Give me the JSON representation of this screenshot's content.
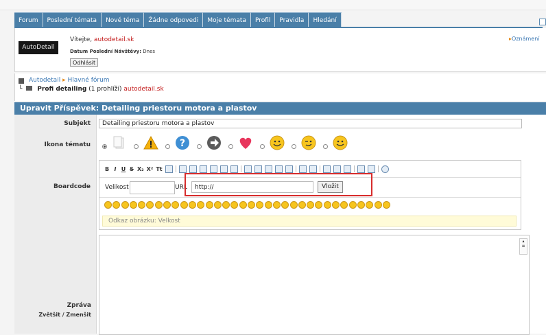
{
  "nav": {
    "tabs": [
      "Forum",
      "Poslední témata",
      "Nové téma",
      "Žádne odpovedi",
      "Moje témata",
      "Profil",
      "Pravidla",
      "Hledání"
    ]
  },
  "welcome": {
    "logo_text": "AutoDetail",
    "greeting": "Vítejte,",
    "username": "autodetail.sk",
    "last_visit_label": "Datum Poslední Návštěvy:",
    "last_visit_value": "Dnes",
    "logout_label": "Odhlásit",
    "announcements_link": "Oznámení"
  },
  "breadcrumb": {
    "root": "Autodetail",
    "forum": "Hlavné fórum",
    "topic": "Profi detailing",
    "viewing": "(1 prohlíží)",
    "viewer": "autodetail.sk"
  },
  "form": {
    "header": "Upravit Příspěvek: Detailing priestoru motora a plastov",
    "subject_label": "Subjekt",
    "subject_value": "Detailing priestoru motora a plastov",
    "icon_label": "Ikona tématu",
    "boardcode_label": "Boardcode",
    "toolbar": [
      "B",
      "I",
      "U",
      "S",
      "X₂",
      "X²",
      "Tt"
    ],
    "velikost_label": "Velikost",
    "url_label": "URL",
    "url_value": "http://",
    "insert_button": "Vložit",
    "hint": "Odkaz obrázku: Velkost",
    "message_label": "Zpráva",
    "enlarge": "Zvětšit",
    "shrink": "Zmenšit"
  },
  "colors": {
    "accent": "#4a7fa8",
    "link": "#3a77b3",
    "username": "#c21818",
    "highlight": "#d72c2c"
  }
}
